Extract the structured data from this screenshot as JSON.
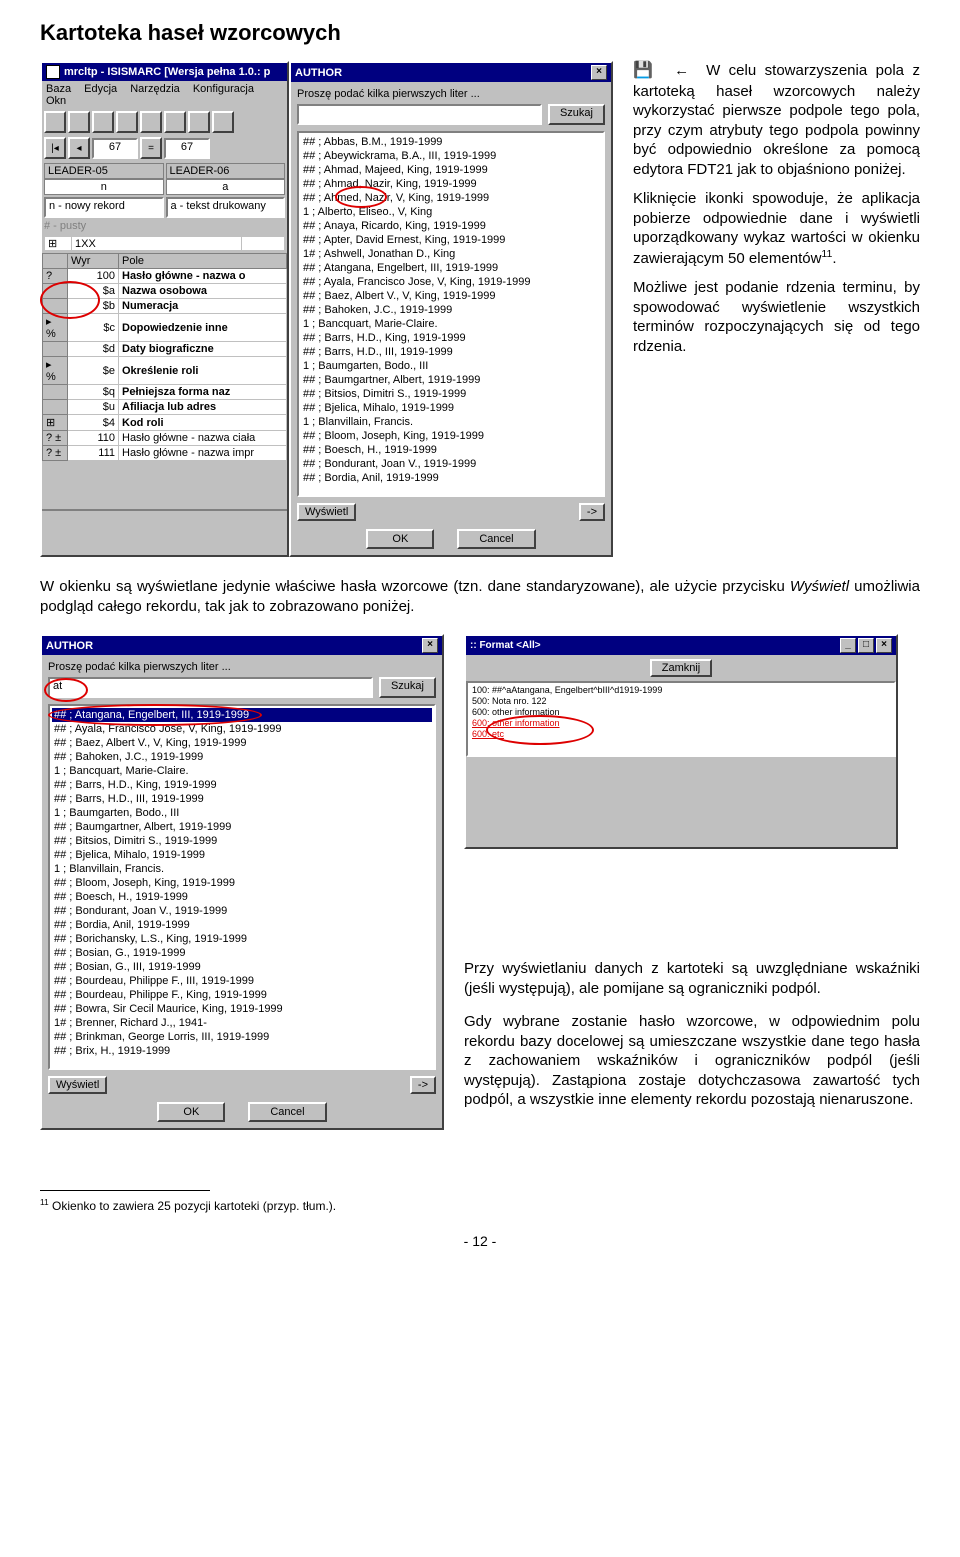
{
  "doc": {
    "title": "Kartoteka haseł wzorcowych",
    "p1": "W celu stowarzyszenia pola z kartoteką haseł wzorcowych należy wykorzystać pierwsze podpole tego pola, przy czym atrybuty tego podpola powinny być odpowiednio określone za pomocą edytora FDT21 jak to objaśniono poniżej.",
    "p2_a": "Kliknięcie ikonki spowoduje, że aplikacja pobierze odpowiednie dane i wyświetli uporządkowany wykaz wartości w okienku zawierającym 50 elementów",
    "p2_sup": "11",
    "p2_b": ".",
    "p3": "Możliwe jest podanie rdzenia terminu, by spowodować wyświetlenie wszystkich terminów rozpoczynających się od tego rdzenia.",
    "mid_a": "W okienku są wyświetlane jedynie właściwe hasła wzorcowe (tzn. dane standaryzowane), ale użycie przycisku ",
    "mid_i": "Wyświetl",
    "mid_b": " umożliwia podgląd całego rekordu, tak jak to zobrazowano poniżej.",
    "col2_p1": "Przy wyświetlaniu danych z kartoteki są uwzględniane wskaźniki (jeśli występują), ale pomijane są ograniczniki podpól.",
    "col2_p2": "Gdy wybrane zostanie hasło wzorcowe, w odpowiednim polu rekordu bazy docelowej są umieszczane wszystkie dane tego hasła z zachowaniem wskaźników i ograniczników podpól (jeśli występują). Zastąpiona zostaje dotychczasowa zawartość tych podpól, a wszystkie inne elementy rekordu pozostają nienaruszone.",
    "footnote_num": "11",
    "footnote_text": " Okienko to zawiera 25 pozycji kartoteki (przyp. tłum.).",
    "page": "- 12 -"
  },
  "mainwin": {
    "title": "mrcltp - ISISMARC [Wersja pełna 1.0.: p",
    "menu": [
      "Baza",
      "Edycja",
      "Narzędzia",
      "Konfiguracja",
      "Okn"
    ],
    "mfn": "67",
    "leader05_lbl": "LEADER-05",
    "leader05_val": "n",
    "leader06_lbl": "LEADER-06",
    "leader06_val": "a",
    "combo1": "n - nowy rekord",
    "combo2": "a - tekst drukowany",
    "empty": "# - pusty",
    "col_wyr": "Wyr",
    "col_pole": "Pole",
    "r100": "100",
    "r100t": "Hasło główne - nazwa o",
    "sa": "$a",
    "sat": "Nazwa osobowa",
    "sb": "$b",
    "sbt": "Numeracja",
    "sc": "$c",
    "sct": "Dopowiedzenie inne",
    "sd": "$d",
    "sdt": "Daty biograficzne",
    "se": "$e",
    "set": "Określenie roli",
    "sq": "$q",
    "sqt": "Pełniejsza forma naz",
    "su": "$u",
    "sut": "Afiliacja lub adres",
    "s4": "$4",
    "s4t": "Kod roli",
    "r110": "110",
    "r110t": "Hasło główne - nazwa ciała",
    "r111": "111",
    "r111t": "Hasło główne - nazwa impr",
    "onexx": "1XX"
  },
  "author": {
    "title": "AUTHOR",
    "prompt": "Proszę podać kilka pierwszych liter ...",
    "szukaj": "Szukaj",
    "ok": "OK",
    "cancel": "Cancel",
    "wyswietl": "Wyświetl",
    "arrow": "->",
    "items": [
      "## ; Abbas, B.M., 1919-1999",
      "## ; Abeywickrama, B.A., III, 1919-1999",
      "## ; Ahmad, Majeed, King, 1919-1999",
      "## ; Ahmad, Nazir, King, 1919-1999",
      "## ; Ahmed, Nazir, V, King, 1919-1999",
      "1  ; Alberto, Eliseo., V, King",
      "## ; Anaya, Ricardo, King, 1919-1999",
      "## ; Apter, David Ernest, King, 1919-1999",
      "1# ; Ashwell, Jonathan D., King",
      "## ; Atangana, Engelbert, III, 1919-1999",
      "## ; Ayala, Francisco Jose, V, King, 1919-1999",
      "## ; Baez, Albert V., V, King, 1919-1999",
      "## ; Bahoken, J.C., 1919-1999",
      "1  ; Bancquart, Marie-Claire.",
      "## ; Barrs, H.D., King, 1919-1999",
      "## ; Barrs, H.D., III, 1919-1999",
      "1  ; Baumgarten, Bodo., III",
      "## ; Baumgartner, Albert, 1919-1999",
      "## ; Bitsios, Dimitri S., 1919-1999",
      "## ; Bjelica, Mihalo, 1919-1999",
      "1  ; Blanvillain, Francis.",
      "## ; Bloom, Joseph, King, 1919-1999",
      "## ; Boesch, H., 1919-1999",
      "## ; Bondurant, Joan V., 1919-1999",
      "## ; Bordia, Anil, 1919-1999"
    ]
  },
  "author2": {
    "input": "at",
    "items": [
      "## ; Atangana, Engelbert, III, 1919-1999",
      "## ; Ayala, Francisco Jose, V, King, 1919-1999",
      "## ; Baez, Albert V., V, King, 1919-1999",
      "## ; Bahoken, J.C., 1919-1999",
      "1  ; Bancquart, Marie-Claire.",
      "## ; Barrs, H.D., King, 1919-1999",
      "## ; Barrs, H.D., III, 1919-1999",
      "1  ; Baumgarten, Bodo., III",
      "## ; Baumgartner, Albert, 1919-1999",
      "## ; Bitsios, Dimitri S., 1919-1999",
      "## ; Bjelica, Mihalo, 1919-1999",
      "1  ; Blanvillain, Francis.",
      "## ; Bloom, Joseph, King, 1919-1999",
      "## ; Boesch, H., 1919-1999",
      "## ; Bondurant, Joan V., 1919-1999",
      "## ; Bordia, Anil, 1919-1999",
      "## ; Borichansky, L.S., King, 1919-1999",
      "## ; Bosian, G., 1919-1999",
      "## ; Bosian, G., III, 1919-1999",
      "## ; Bourdeau, Philippe F., III, 1919-1999",
      "## ; Bourdeau, Philippe F., King, 1919-1999",
      "## ; Bowra, Sir Cecil Maurice, King, 1919-1999",
      "1# ; Brenner, Richard J.,, 1941-",
      "## ; Brinkman, George Lorris, III, 1919-1999",
      "## ; Brix, H., 1919-1999"
    ]
  },
  "format": {
    "title": ":: Format <All>",
    "zamknij": "Zamknij",
    "lines": [
      "100:   ##^aAtangana, Engelbert^bIII^d1919-1999",
      "500:   Nota nro. 122",
      "600:   other information",
      "600:   other information",
      "600:   etc"
    ]
  },
  "glyph": {
    "save": "💾",
    "arrow_left": "←"
  }
}
